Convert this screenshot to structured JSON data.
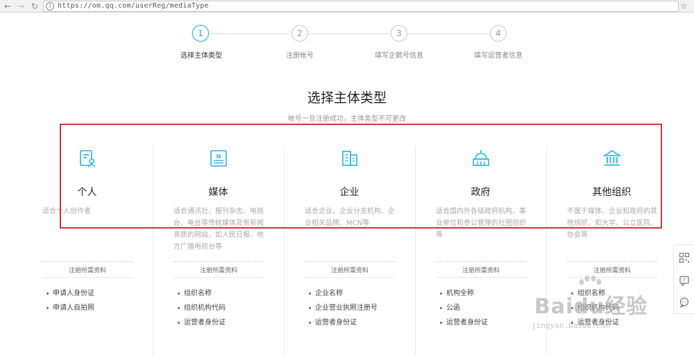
{
  "browser": {
    "url": "https://om.qq.com/userReg/mediaType",
    "icons": {
      "back": "arrow-left-icon",
      "forward": "arrow-right-icon",
      "reload": "reload-icon",
      "info": "info-icon",
      "star": "star-icon"
    }
  },
  "steps": [
    {
      "number": "1",
      "label": "选择主体类型",
      "active": true
    },
    {
      "number": "2",
      "label": "注册帐号",
      "active": false
    },
    {
      "number": "3",
      "label": "填写企鹅号信息",
      "active": false
    },
    {
      "number": "4",
      "label": "填写运营者信息",
      "active": false
    }
  ],
  "heading": {
    "title": "选择主体类型",
    "subtitle": "帐号一旦注册成功，主体类型不可更改"
  },
  "types": [
    {
      "name": "个人",
      "icon": "person-card-icon",
      "desc": "适合个人创作者",
      "req_title": "注册所需资料",
      "reqs": [
        "申请人身份证",
        "申请人自拍照"
      ]
    },
    {
      "name": "媒体",
      "icon": "newspaper-icon",
      "desc": "适合通讯社、报刊杂志、电视台、电台等传统媒体及有新闻资质的网站，如人民日报、地方广播电视台等",
      "req_title": "注册所需资料",
      "reqs": [
        "组织名称",
        "组织机构代码",
        "运营者身份证"
      ]
    },
    {
      "name": "企业",
      "icon": "building-icon",
      "desc": "适合企业、企业分支机构、企业相关品牌、MCN等",
      "req_title": "注册所需资料",
      "reqs": [
        "企业名称",
        "企业营业执照注册号",
        "运营者身份证"
      ]
    },
    {
      "name": "政府",
      "icon": "government-dome-icon",
      "desc": "适合国内外各级政府机构、事业单位和参公管理的社团组织等",
      "req_title": "注册所需资料",
      "reqs": [
        "机构全称",
        "公函",
        "运营者身份证"
      ]
    },
    {
      "name": "其他组织",
      "icon": "institution-icon",
      "desc": "不属于媒体、企业和政府的其他组织，如大学、公立医院、协会等",
      "req_title": "注册所需资料",
      "reqs": [
        "组织名称",
        "组织机构代码",
        "运营者身份证"
      ]
    }
  ],
  "sidebar": {
    "icons": [
      "qr-code-icon",
      "help-icon",
      "chat-icon"
    ]
  },
  "watermark": {
    "main": "Baidu经验",
    "url": "jingyan.baidu.com"
  },
  "colors": {
    "accent": "#2ab0d8",
    "highlight_box": "#c9383d"
  }
}
